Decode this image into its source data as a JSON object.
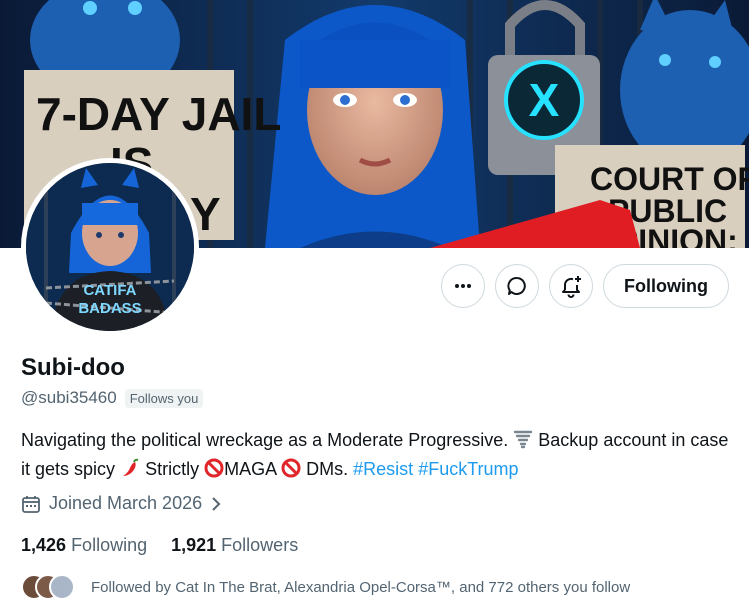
{
  "banner": {
    "sign_left": [
      "7-DAY JAIL",
      "IS",
      "Y"
    ],
    "sign_right": [
      "COURT OF",
      "PUBLIC",
      "OPINION:"
    ],
    "lock_logo": "X"
  },
  "avatar": {
    "shirt_text": [
      "CATIFA",
      "BADASS"
    ]
  },
  "actions": {
    "more_icon": "more-icon",
    "message_icon": "message-icon",
    "notify_icon": "bell-plus-icon",
    "following_label": "Following"
  },
  "profile": {
    "name": "Subi-doo",
    "handle": "@subi35460",
    "follows_you": "Follows you",
    "bio_part1": "Navigating the political wreckage as a Moderate Progressive.",
    "bio_part2": "Backup account in case it gets spicy",
    "bio_part3": "Strictly",
    "bio_part4": "MAGA",
    "bio_part5": "DMs.",
    "hashtag1": "#Resist",
    "hashtag2": "#FuckTrump",
    "joined": "Joined March 2026"
  },
  "stats": {
    "following_count": "1,426",
    "following_label": "Following",
    "followers_count": "1,921",
    "followers_label": "Followers"
  },
  "followed_by": {
    "text": "Followed by Cat In The Brat, Alexandria Opel-Corsa™, and 772 others you follow"
  },
  "colors": {
    "accent": "#1d9bf0",
    "secondary_text": "#536471",
    "border": "#cfd9de"
  }
}
